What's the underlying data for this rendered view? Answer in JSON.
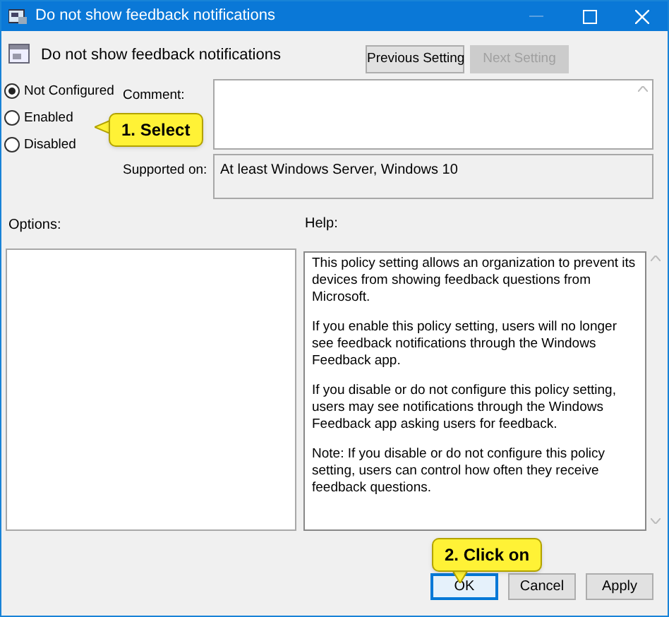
{
  "window": {
    "title": "Do not show feedback notifications"
  },
  "header": {
    "title": "Do not show feedback notifications"
  },
  "nav_buttons": [
    {
      "label": "Previous Setting",
      "disabled": false
    },
    {
      "label": "Next Setting",
      "disabled": true
    }
  ],
  "state_options": [
    {
      "label": "Not Configured",
      "selected": true
    },
    {
      "label": "Enabled",
      "selected": false
    },
    {
      "label": "Disabled",
      "selected": false
    }
  ],
  "comment": {
    "label": "Comment:"
  },
  "supported_on": {
    "label": "Supported on:",
    "value": "At least Windows Server, Windows 10"
  },
  "options": {
    "label": "Options:"
  },
  "help": {
    "label": "Help:",
    "paragraphs": [
      "This policy setting allows an organization to prevent its devices from showing feedback questions from Microsoft.",
      "If you enable this policy setting, users will no longer see feedback notifications through the Windows Feedback app.",
      "If you disable or do not configure this policy setting, users may see notifications through the Windows Feedback app asking users for feedback.",
      "Note: If you disable or do not configure this policy setting, users can control how often they receive feedback questions."
    ]
  },
  "footer_buttons": [
    {
      "label": "OK",
      "focused": true
    },
    {
      "label": "Cancel",
      "focused": false
    },
    {
      "label": "Apply",
      "focused": false
    }
  ],
  "callouts": [
    {
      "text": "1. Select"
    },
    {
      "text": "2. Click on"
    }
  ]
}
